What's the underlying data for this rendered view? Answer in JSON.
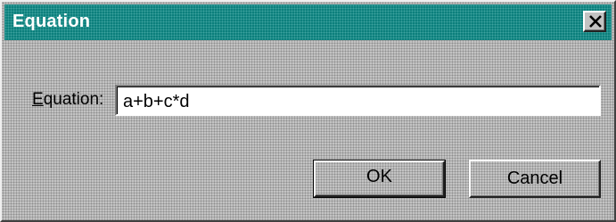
{
  "window": {
    "title": "Equation",
    "close_icon": "close-icon"
  },
  "form": {
    "label_accel": "E",
    "label_rest": "quation:",
    "value": "a+b+c*d"
  },
  "buttons": {
    "ok_label": "OK",
    "cancel_label": "Cancel"
  },
  "colors": {
    "titlebar": "#0c7f7c",
    "dialog_face": "#c3c3c3"
  }
}
